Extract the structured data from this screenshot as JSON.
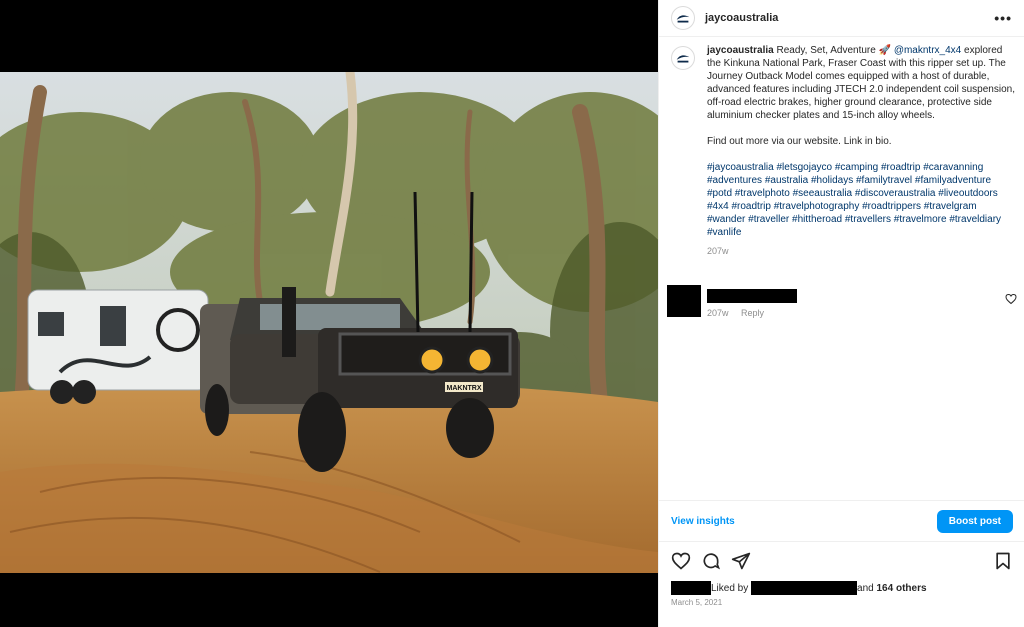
{
  "post": {
    "username": "jaycoaustralia",
    "more_label": "•••"
  },
  "caption": {
    "username": "jaycoaustralia",
    "text_before_mention": " Ready, Set, Adventure 🚀 ",
    "mention": "@makntrx_4x4",
    "text_after_mention": " explored the Kinkuna National Park, Fraser Coast with this ripper set up. The Journey Outback Model comes equipped with a host of durable, advanced features including JTECH 2.0 independent coil suspension, off-road electric brakes, higher ground clearance, protective side aluminium checker plates and 15-inch alloy wheels.",
    "paragraph2": "Find out more via our website. Link in bio.",
    "hashtags": "#jaycoaustralia #letsgojayco #camping #roadtrip #caravanning #adventures #australia #holidays #familytravel #familyadventure #potd #travelphoto #seeaustralia #discoveraustralia #liveoutdoors #4x4 #roadtrip #travelphotography #roadtrippers #travelgram #wander #traveller #hittheroad #travellers #travelmore #traveldiary #vanlife",
    "age": "207w"
  },
  "comment": {
    "age": "207w",
    "reply_label": "Reply"
  },
  "insights": {
    "view_label": "View insights",
    "boost_label": "Boost post"
  },
  "likes": {
    "liked_by": "Liked by",
    "and_label": "and",
    "others": "164 others"
  },
  "date": "March 5, 2021",
  "photo": {
    "plate_text": "MAKNTRX"
  },
  "icons": [
    "heart-icon",
    "comment-icon",
    "share-icon",
    "bookmark-icon",
    "more-icon"
  ]
}
